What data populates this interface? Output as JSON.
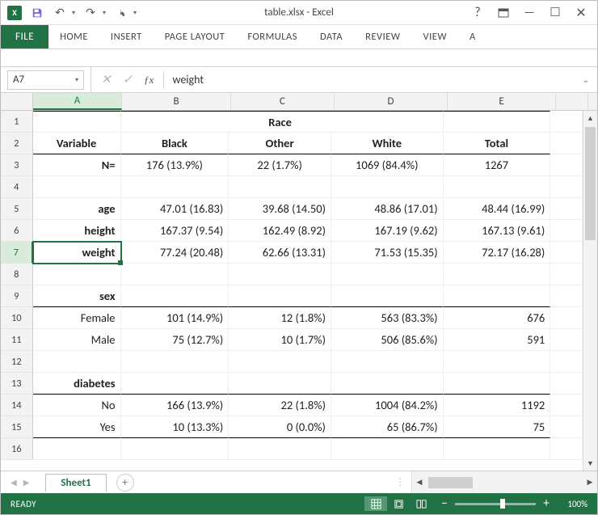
{
  "title": "table.xlsx - Excel",
  "qat": {
    "excel_logo": "X"
  },
  "ribbon": {
    "file": "FILE",
    "tabs": [
      "HOME",
      "INSERT",
      "PAGE LAYOUT",
      "FORMULAS",
      "DATA",
      "REVIEW",
      "VIEW",
      "A"
    ]
  },
  "namebox": "A7",
  "formula_value": "weight",
  "columns": [
    "A",
    "B",
    "C",
    "D",
    "E"
  ],
  "chart_data": {
    "type": "table",
    "header_span": "Race",
    "headers": {
      "var": "Variable",
      "black": "Black",
      "other": "Other",
      "white": "White",
      "total": "Total"
    },
    "n_label": "N=",
    "n": {
      "black": "176 (13.9%)",
      "other": "22 (1.7%)",
      "white": "1069 (84.4%)",
      "total": "1267"
    },
    "vars": {
      "age": {
        "label": "age",
        "black": "47.01 (16.83)",
        "other": "39.68 (14.50)",
        "white": "48.86 (17.01)",
        "total": "48.44 (16.99)"
      },
      "height": {
        "label": "height",
        "black": "167.37 (9.54)",
        "other": "162.49 (8.92)",
        "white": "167.19 (9.62)",
        "total": "167.13 (9.61)"
      },
      "weight": {
        "label": "weight",
        "black": "77.24 (20.48)",
        "other": "62.66 (13.31)",
        "white": "71.53 (15.35)",
        "total": "72.17 (16.28)"
      }
    },
    "sex": {
      "label": "sex",
      "rows": {
        "female": {
          "label": "Female",
          "black": "101 (14.9%)",
          "other": "12 (1.8%)",
          "white": "563 (83.3%)",
          "total": "676"
        },
        "male": {
          "label": "Male",
          "black": "75 (12.7%)",
          "other": "10 (1.7%)",
          "white": "506 (85.6%)",
          "total": "591"
        }
      }
    },
    "diabetes": {
      "label": "diabetes",
      "rows": {
        "no": {
          "label": "No",
          "black": "166 (13.9%)",
          "other": "22 (1.8%)",
          "white": "1004 (84.2%)",
          "total": "1192"
        },
        "yes": {
          "label": "Yes",
          "black": "10 (13.3%)",
          "other": "0 (0.0%)",
          "white": "65 (86.7%)",
          "total": "75"
        }
      }
    }
  },
  "sheet": {
    "name": "Sheet1"
  },
  "status": {
    "ready": "READY",
    "zoom": "100%"
  }
}
